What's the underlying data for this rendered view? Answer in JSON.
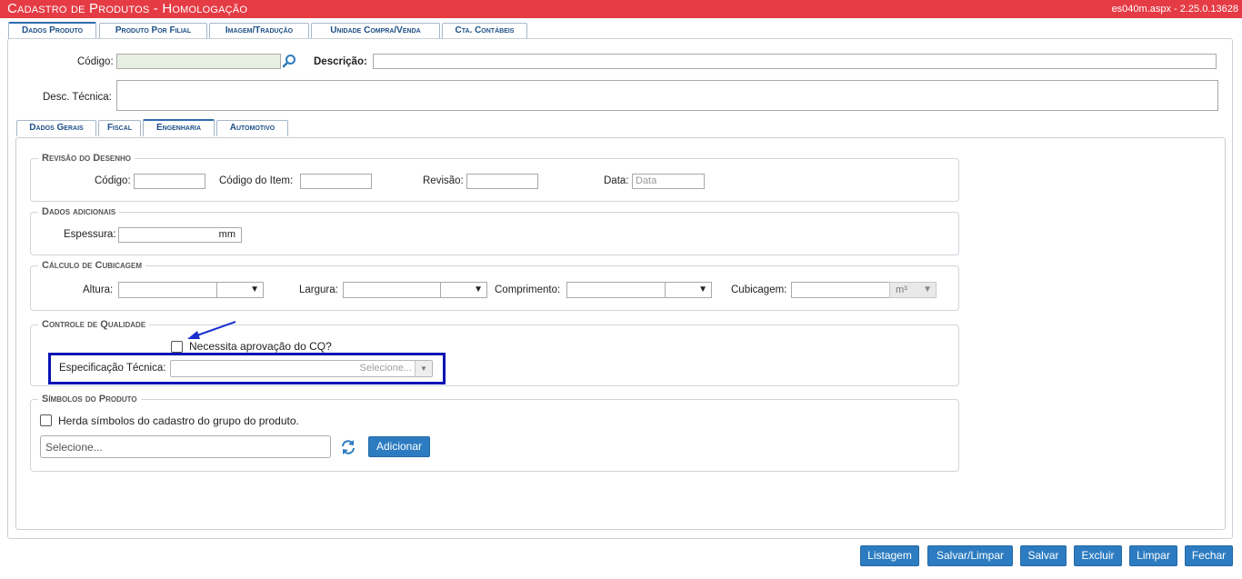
{
  "header": {
    "title": "Cadastro de Produtos  - Homologação",
    "version": "es040m.aspx - 2.25.0.13628"
  },
  "main_tabs": [
    {
      "label": "Dados Produto",
      "active": true
    },
    {
      "label": "Produto Por Filial",
      "active": false
    },
    {
      "label": "Imagem/Tradução",
      "active": false
    },
    {
      "label": "Unidade Compra/Venda",
      "active": false
    },
    {
      "label": "Cta. Contábeis",
      "active": false
    }
  ],
  "top_form": {
    "codigo_label": "Código:",
    "codigo_value": "",
    "descricao_label": "Descrição:",
    "descricao_value": "",
    "desc_tecnica_label": "Desc. Técnica:",
    "desc_tecnica_value": ""
  },
  "sub_tabs": [
    {
      "label": "Dados Gerais",
      "active": false
    },
    {
      "label": "Fiscal",
      "active": false
    },
    {
      "label": "Engenharia",
      "active": true
    },
    {
      "label": "Automotivo",
      "active": false
    }
  ],
  "revisao": {
    "legend": "Revisão do Desenho",
    "codigo_label": "Código:",
    "codigo_item_label": "Código do Item:",
    "revisao_label": "Revisão:",
    "data_label": "Data:",
    "data_placeholder": "Data"
  },
  "dados_adicionais": {
    "legend": "Dados adicionais",
    "espessura_label": "Espessura:",
    "unit": "mm"
  },
  "cubicagem": {
    "legend": "Cálculo de Cubicagem",
    "altura_label": "Altura:",
    "largura_label": "Largura:",
    "comprimento_label": "Comprimento:",
    "cubicagem_label": "Cubicagem:",
    "cubicagem_unit": "m³"
  },
  "qualidade": {
    "legend": "Controle de Qualidade",
    "checkbox_label": "Necessita aprovação do CQ?",
    "espec_label": "Especificação Técnica:",
    "espec_placeholder": "Selecione..."
  },
  "simbolos": {
    "legend": "Símbolos do Produto",
    "checkbox_label": "Herda símbolos do cadastro do grupo do produto.",
    "select_placeholder": "Selecione...",
    "add_label": "Adicionar"
  },
  "footer_buttons": {
    "listagem": "Listagem",
    "salvar_limpar": "Salvar/Limpar",
    "salvar": "Salvar",
    "excluir": "Excluir",
    "limpar": "Limpar",
    "fechar": "Fechar"
  },
  "colors": {
    "header_bg": "#e53b44",
    "tab_text": "#1d4f86",
    "button_bg": "#2d7cc1",
    "highlight_border": "#0a14b4",
    "annotation_arrow": "#1a2fd0"
  }
}
